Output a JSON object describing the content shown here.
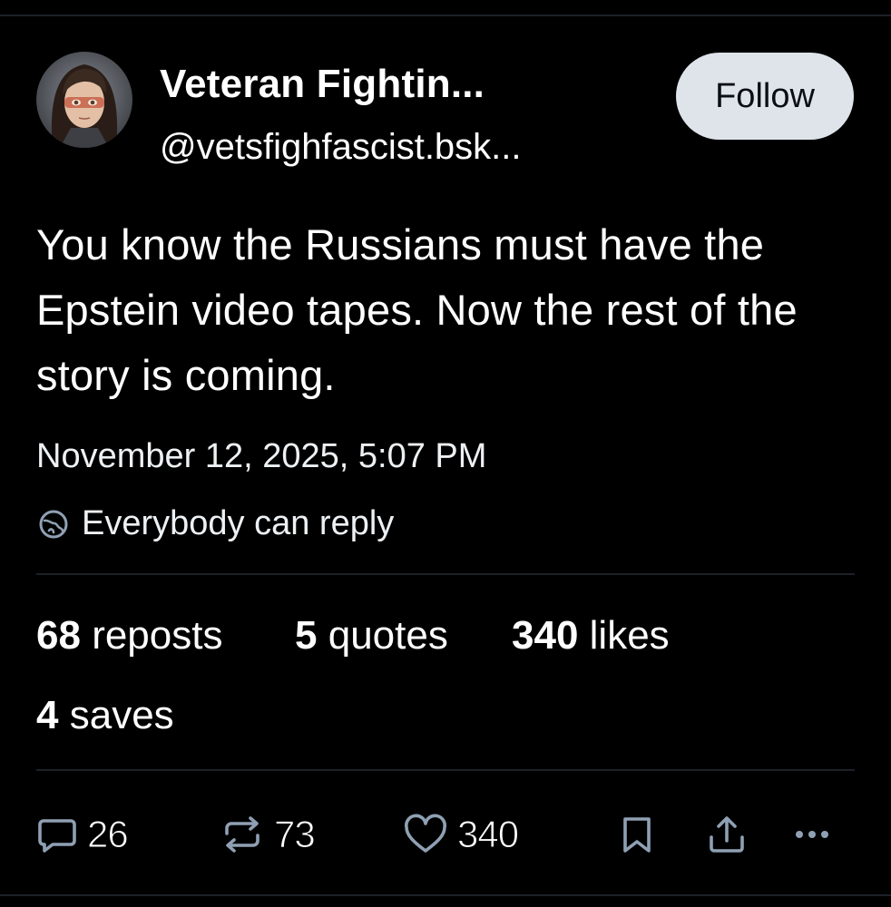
{
  "post": {
    "author": {
      "display_name": "Veteran Fightin...",
      "handle": "@vetsfighfascist.bsk..."
    },
    "follow_label": "Follow",
    "text": "You know the Russians must have the Epstein video tapes. Now the rest of the story is coming.",
    "timestamp": "November 12, 2025, 5:07 PM",
    "reply_setting": "Everybody can reply"
  },
  "stats": {
    "reposts": {
      "count": "68",
      "label": "reposts"
    },
    "quotes": {
      "count": "5",
      "label": "quotes"
    },
    "likes": {
      "count": "340",
      "label": "likes"
    },
    "saves": {
      "count": "4",
      "label": "saves"
    }
  },
  "actions": {
    "reply_count": "26",
    "repost_count": "73",
    "like_count": "340"
  },
  "icons": {
    "reply": "speech-bubble-icon",
    "repost": "repost-arrows-icon",
    "like": "heart-icon",
    "bookmark": "bookmark-icon",
    "share": "share-icon",
    "more": "more-dots-icon",
    "reply_setting": "globe-icon"
  },
  "colors": {
    "background": "#000000",
    "text": "#ffffff",
    "follow_button_bg": "#dfe4ea",
    "divider": "#1c2128"
  }
}
